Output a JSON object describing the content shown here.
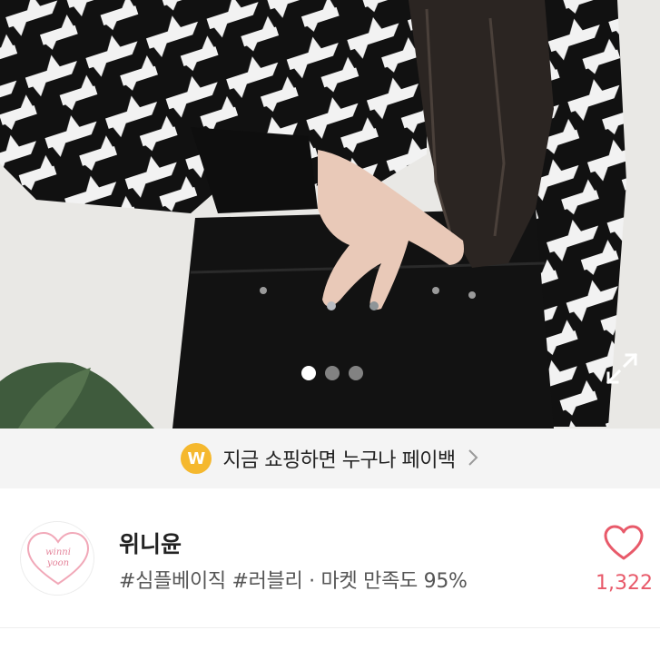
{
  "gallery": {
    "slide_count": 3,
    "active_slide": 1
  },
  "promo": {
    "text": "지금 쇼핑하면 누구나 페이백",
    "coin_letter": "W",
    "coin_color": "#f5b82e"
  },
  "shop": {
    "name": "위니윤",
    "tags": "#심플베이직 #러블리 · 마켓 만족도 95%",
    "avatar_text_line1": "winni",
    "avatar_text_line2": "yoon",
    "likes": "1,322",
    "accent_color": "#e85a6a"
  }
}
